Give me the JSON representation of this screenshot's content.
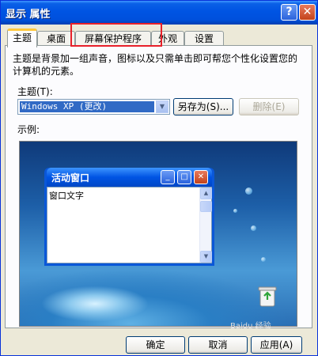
{
  "window": {
    "title": "显示 属性",
    "help_glyph": "?",
    "close_glyph": "✕"
  },
  "tabs": [
    {
      "label": "主题",
      "active": true
    },
    {
      "label": "桌面",
      "active": false
    },
    {
      "label": "屏幕保护程序",
      "active": false
    },
    {
      "label": "外观",
      "active": false
    },
    {
      "label": "设置",
      "active": false
    }
  ],
  "theme_page": {
    "description": "主题是背景加一组声音，图标以及只需单击即可帮您个性化设置您的计算机的元素。",
    "theme_label": "主题(T):",
    "theme_value": "Windows XP (更改)",
    "save_as_label": "另存为(S)...",
    "delete_label": "删除(E)",
    "sample_label": "示例:"
  },
  "preview": {
    "window_title": "活动窗口",
    "window_text": "窗口文字"
  },
  "footer": {
    "ok_label": "确定",
    "cancel_label": "取消",
    "apply_label": "应用(A)"
  },
  "watermark": "Baidu 经验",
  "colors": {
    "titlebar": "#0054e3",
    "face": "#ece9d8",
    "active_tab_accent": "#ffc83c",
    "highlight_box": "#e8202a",
    "selection": "#316ac5"
  },
  "icons": [
    "help-icon",
    "close-icon",
    "dropdown-arrow-icon",
    "minimize-icon",
    "maximize-icon",
    "recycle-bin-icon"
  ]
}
